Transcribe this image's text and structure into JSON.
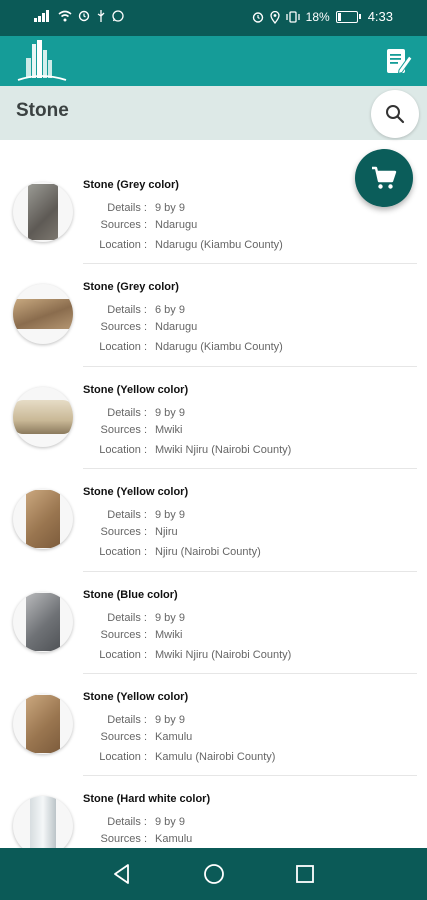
{
  "status_bar": {
    "battery": "18%",
    "time": "4:33",
    "battery_level": 0.18,
    "left_icons": [
      "signal-icon",
      "wifi-icon",
      "alarm-settings-icon",
      "usb-icon",
      "whatsapp-icon"
    ],
    "right_icons": [
      "alarm-icon",
      "location-icon",
      "vibrate-icon",
      "battery-icon"
    ]
  },
  "app_bar": {
    "logo_icon": "city-skyline-logo",
    "action_icon": "document-edit-icon"
  },
  "page": {
    "title": "Stone",
    "search_icon": "search-icon",
    "cart_icon": "cart-icon"
  },
  "labels": {
    "details": "Details :",
    "sources": "Sources :",
    "location": "Location :"
  },
  "items": [
    {
      "name": "Stone (Grey color)",
      "details": "9 by 9",
      "sources": "Ndarugu",
      "location": "Ndarugu (Kiambu County)",
      "image": "grey-stone-block"
    },
    {
      "name": "Stone (Grey color)",
      "details": "6 by 9",
      "sources": "Ndarugu",
      "location": "Ndarugu (Kiambu County)",
      "image": "grey-stone-slab"
    },
    {
      "name": "Stone (Yellow color)",
      "details": "9 by 9",
      "sources": "Mwiki",
      "location": "Mwiki Njiru (Nairobi County)",
      "image": "yellow-stone-pile"
    },
    {
      "name": "Stone (Yellow color)",
      "details": "9 by 9",
      "sources": "Njiru",
      "location": "Njiru (Nairobi County)",
      "image": "yellow-stone-block"
    },
    {
      "name": "Stone (Blue color)",
      "details": "9 by 9",
      "sources": "Mwiki",
      "location": "Mwiki Njiru (Nairobi County)",
      "image": "blue-stone-block"
    },
    {
      "name": "Stone (Yellow color)",
      "details": "9 by 9",
      "sources": "Kamulu",
      "location": "Kamulu (Nairobi County)",
      "image": "yellow-stone-block"
    },
    {
      "name": "Stone (Hard white color)",
      "details": "9 by 9",
      "sources": "Kamulu",
      "location": "",
      "image": "white-stone-block"
    }
  ],
  "nav": {
    "back_icon": "back-icon",
    "home_icon": "home-icon",
    "recents_icon": "recents-icon"
  },
  "colors": {
    "status_bar": "#0b5a57",
    "app_bar": "#159c98",
    "title_bar": "#dde9e7",
    "fab": "#0b5d5a"
  }
}
